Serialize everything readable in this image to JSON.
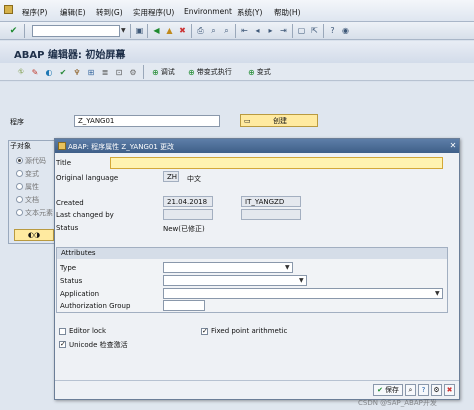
{
  "menu": {
    "items": [
      "程序(P)",
      "编辑(E)",
      "转到(G)",
      "实用程序(U)",
      "Environment",
      "系统(Y)",
      "帮助(H)"
    ]
  },
  "toolbar": {
    "icons": [
      "confirm-check-icon",
      "save-icon",
      "back-icon",
      "exit-icon",
      "cancel-icon",
      "print-icon",
      "find-icon",
      "find-next-icon",
      "first-page-icon",
      "prev-page-icon",
      "next-page-icon",
      "last-page-icon",
      "new-session-icon",
      "shortcut-icon",
      "help-icon",
      "customize-icon"
    ]
  },
  "page": {
    "title": "ABAP 编辑器: 初始屏幕"
  },
  "app_toolbar": {
    "test_label": "调试",
    "debug_run_label": "带变式执行",
    "variant_label": "变式"
  },
  "main": {
    "program_label": "程序",
    "program_value": "Z_YANG01",
    "create_button": "创建",
    "subobjects_title": "子对象",
    "subobjects": [
      "源代码",
      "变式",
      "属性",
      "文档",
      "文本元素"
    ]
  },
  "dialog": {
    "title": "ABAP: 程序属性 Z_YANG01 更改",
    "title_label": "Title",
    "title_value": "",
    "orig_lang_label": "Original language",
    "orig_lang_code": "ZH",
    "orig_lang_name": "中文",
    "created_label": "Created",
    "created_date": "21.04.2018",
    "created_user": "IT_YANGZD",
    "last_changed_label": "Last changed by",
    "status_label": "Status",
    "status_value": "New(已修正)",
    "attributes": {
      "header": "Attributes",
      "type_label": "Type",
      "status_label": "Status",
      "application_label": "Application",
      "auth_group_label": "Authorization Group"
    },
    "editor_lock_label": "Editor lock",
    "editor_lock_checked": false,
    "fixed_point_label": "Fixed point arithmetic",
    "fixed_point_checked": true,
    "unicode_label": "Unicode 检查激活",
    "unicode_checked": true,
    "save_button": "保存"
  },
  "watermark": "CSDN @SAP_ABAP开发"
}
